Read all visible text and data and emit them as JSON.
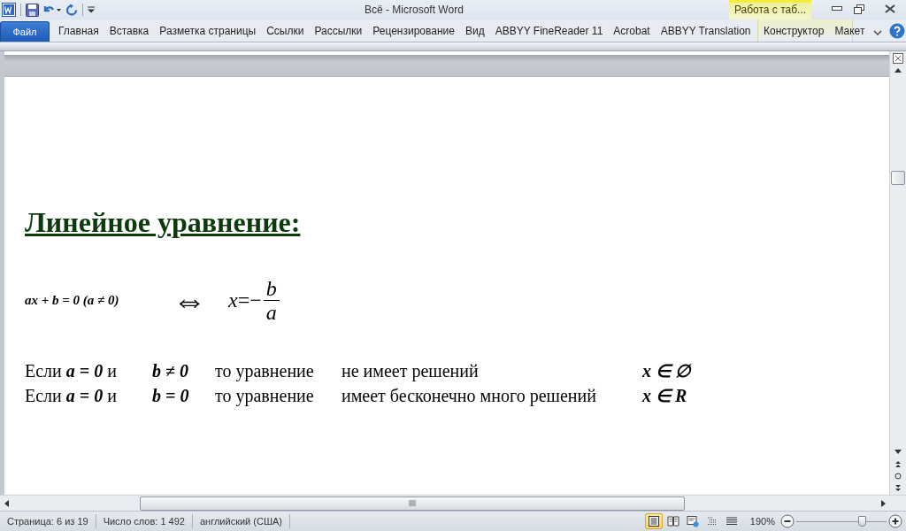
{
  "title_bar": {
    "title": "Всё  -  Microsoft Word",
    "contextual_tab": "Работа с таб..."
  },
  "ribbon": {
    "file_tab": "Файл",
    "tabs": [
      {
        "label": "Главная"
      },
      {
        "label": "Вставка"
      },
      {
        "label": "Разметка страницы"
      },
      {
        "label": "Ссылки"
      },
      {
        "label": "Рассылки"
      },
      {
        "label": "Рецензирование"
      },
      {
        "label": "Вид"
      },
      {
        "label": "ABBYY FineReader 11"
      },
      {
        "label": "Acrobat"
      },
      {
        "label": "ABBYY Translation"
      }
    ],
    "contextual_tabs": [
      {
        "label": "Конструктор"
      },
      {
        "label": "Макет"
      }
    ]
  },
  "document": {
    "heading": "Линейное уравнение:",
    "equation": "ax + b = 0 (a ≠ 0)",
    "equivalence": "⇔",
    "solution": {
      "lhs": "x",
      "sign": "=−",
      "numerator": "b",
      "denominator": "a"
    },
    "rows": [
      [
        {
          "kind": "text",
          "text": "Если **a = 0**  и"
        },
        {
          "kind": "formula",
          "text": "b ≠ 0"
        },
        {
          "kind": "text",
          "text": "то уравнение"
        },
        {
          "kind": "text",
          "text": "не имеет решений"
        },
        {
          "kind": "formula",
          "text": "x ∈ ∅"
        }
      ],
      [
        {
          "kind": "text",
          "text": "Если **a = 0**  и"
        },
        {
          "kind": "formula",
          "text": "b = 0"
        },
        {
          "kind": "text",
          "text": "то уравнение"
        },
        {
          "kind": "text",
          "text": "имеет бесконечно много решений"
        },
        {
          "kind": "formula",
          "text": "x ∈ R"
        }
      ]
    ]
  },
  "status_bar": {
    "page": "Страница: 6 из 19",
    "words": "Число слов: 1 492",
    "language": "английский (США)",
    "views": [
      {
        "kind": "print",
        "selected": true
      },
      {
        "kind": "reading",
        "selected": false
      },
      {
        "kind": "web",
        "selected": false
      },
      {
        "kind": "outline",
        "selected": false
      },
      {
        "kind": "draft",
        "selected": false
      }
    ],
    "zoom": "190%",
    "zoom_slider": {
      "level": 0.73
    }
  }
}
